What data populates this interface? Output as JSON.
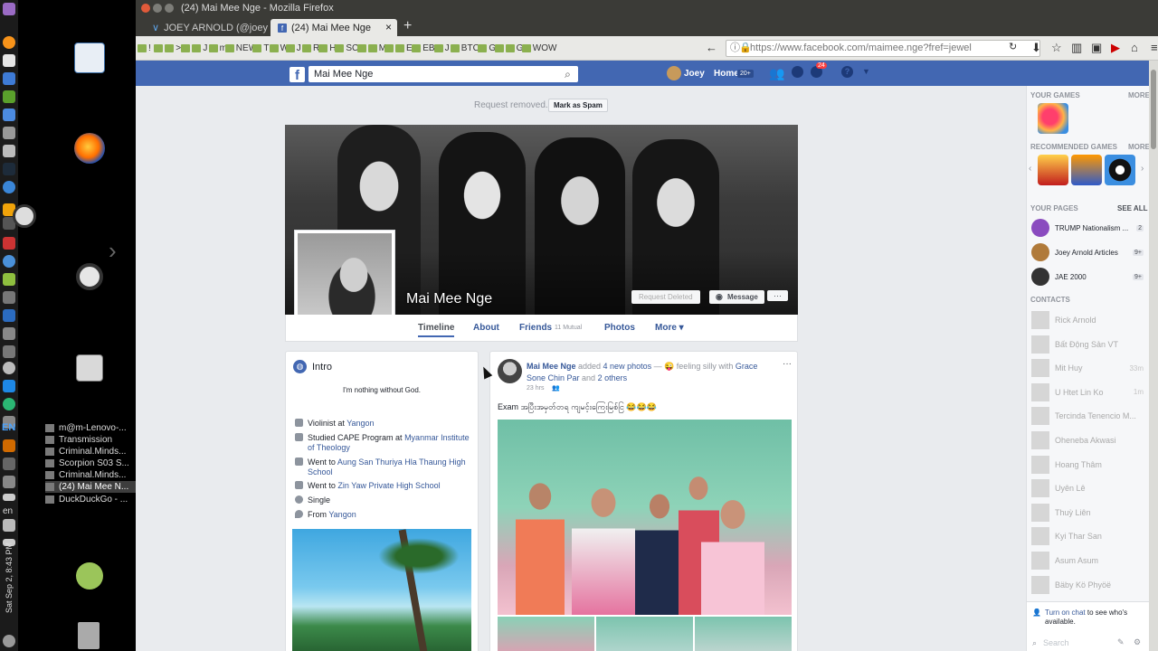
{
  "window": {
    "title": "(24) Mai Mee Nge - Mozilla Firefox"
  },
  "tabs": [
    {
      "label": "JOEY ARNOLD (@joey"
    },
    {
      "label": "(24) Mai Mee Nge"
    }
  ],
  "bookmarks": [
    "!",
    "",
    ">",
    "",
    "J",
    "m",
    "NEW",
    "T",
    "W",
    "J",
    "R",
    "H",
    "SC",
    "",
    "M",
    "",
    "E",
    "EB",
    "J",
    "BTC",
    "G",
    "",
    "G",
    "WOW"
  ],
  "url": {
    "host": "https://www.facebook.com",
    "path": "/maimee.nge?fref=jewel"
  },
  "taskbar": [
    {
      "label": "m@m-Lenovo-..."
    },
    {
      "label": "Transmission"
    },
    {
      "label": "Criminal.Minds..."
    },
    {
      "label": "Scorpion S03 S..."
    },
    {
      "label": "Criminal.Minds..."
    },
    {
      "label": "(24) Mai Mee N..."
    },
    {
      "label": "DuckDuckGo - ..."
    }
  ],
  "sidebar": {
    "lang": "EN",
    "locale": "en",
    "clock": "Sat Sep 2, 8:43 PM"
  },
  "fb": {
    "search": "Mai Mee Nge",
    "user": "Joey",
    "home": "Home",
    "home_count": "20+",
    "notif_count": "24",
    "request_removed": "Request removed.",
    "mark_spam": "Mark as Spam",
    "profile_name": "Mai Mee Nge",
    "request_deleted": "Request Deleted",
    "message": "Message",
    "nav": {
      "timeline": "Timeline",
      "about": "About",
      "friends": "Friends",
      "friends_mutual": "11 Mutual",
      "photos": "Photos",
      "more": "More ▾"
    }
  },
  "intro": {
    "title": "Intro",
    "bio": "I'm nothing without God.",
    "violinist_pre": "Violinist at ",
    "violinist_place": "Yangon",
    "studied_pre": "Studied CAPE Program at ",
    "studied_place": "Myanmar Institute of Theology",
    "went1_pre": "Went to ",
    "went1_place": "Aung San Thuriya Hla Thaung High School",
    "went2_pre": "Went to ",
    "went2_place": "Zin Yaw Private High School",
    "relationship": "Single",
    "from_pre": "From ",
    "from_place": "Yangon"
  },
  "post": {
    "author": "Mai Mee Nge",
    "added": " added ",
    "photos": "4 new photos",
    "feeling": " — 😜 feeling silly with ",
    "with1": "Grace Sone Chin Par",
    "and": " and ",
    "others": "2 others",
    "time": "23 hrs",
    "text": "Exam အပြီးအမှတ်တရ ကျမင့်းကြေးမြစ်ငြ 😂😂😂"
  },
  "right": {
    "your_games": "YOUR GAMES",
    "more": "MORE",
    "recommended_games": "RECOMMENDED GAMES",
    "your_pages": "YOUR PAGES",
    "see_all": "SEE ALL",
    "pages": [
      {
        "name": "TRUMP Nationalism ...",
        "count": "2"
      },
      {
        "name": "Joey Arnold Articles",
        "count": "9+"
      },
      {
        "name": "JAE 2000",
        "count": "9+"
      }
    ],
    "contacts_title": "CONTACTS",
    "contacts": [
      {
        "name": "Rick Arnold",
        "t": ""
      },
      {
        "name": "Bất Động Sản VT",
        "t": ""
      },
      {
        "name": "Mit Huy",
        "t": "33m"
      },
      {
        "name": "U Htet Lin Ko",
        "t": "1m"
      },
      {
        "name": "Tercinda Tenencio M...",
        "t": ""
      },
      {
        "name": "Oheneba Akwasi",
        "t": ""
      },
      {
        "name": "Hoang Thâm",
        "t": ""
      },
      {
        "name": "Uyên Lê",
        "t": ""
      },
      {
        "name": "Thuỳ Liên",
        "t": ""
      },
      {
        "name": "Kyi Thar San",
        "t": ""
      },
      {
        "name": "Asum Asum",
        "t": ""
      },
      {
        "name": "Bäby Kö Phyöë",
        "t": ""
      }
    ],
    "chat_link": "Turn on chat",
    "chat_rest": " to see who's available.",
    "search_placeholder": "Search"
  }
}
